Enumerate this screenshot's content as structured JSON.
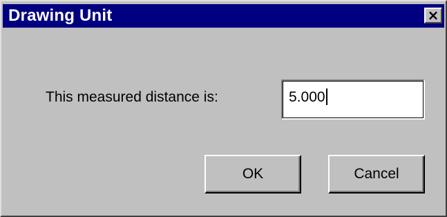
{
  "dialog": {
    "title": "Drawing Unit",
    "close_glyph": "×",
    "close_icon": "close-icon"
  },
  "form": {
    "label": "This measured distance is:",
    "value": "5.000"
  },
  "buttons": {
    "ok_label": "OK",
    "cancel_label": "Cancel"
  },
  "colors": {
    "title_bar": "#000080",
    "dialog_face": "#c0c0c0"
  }
}
